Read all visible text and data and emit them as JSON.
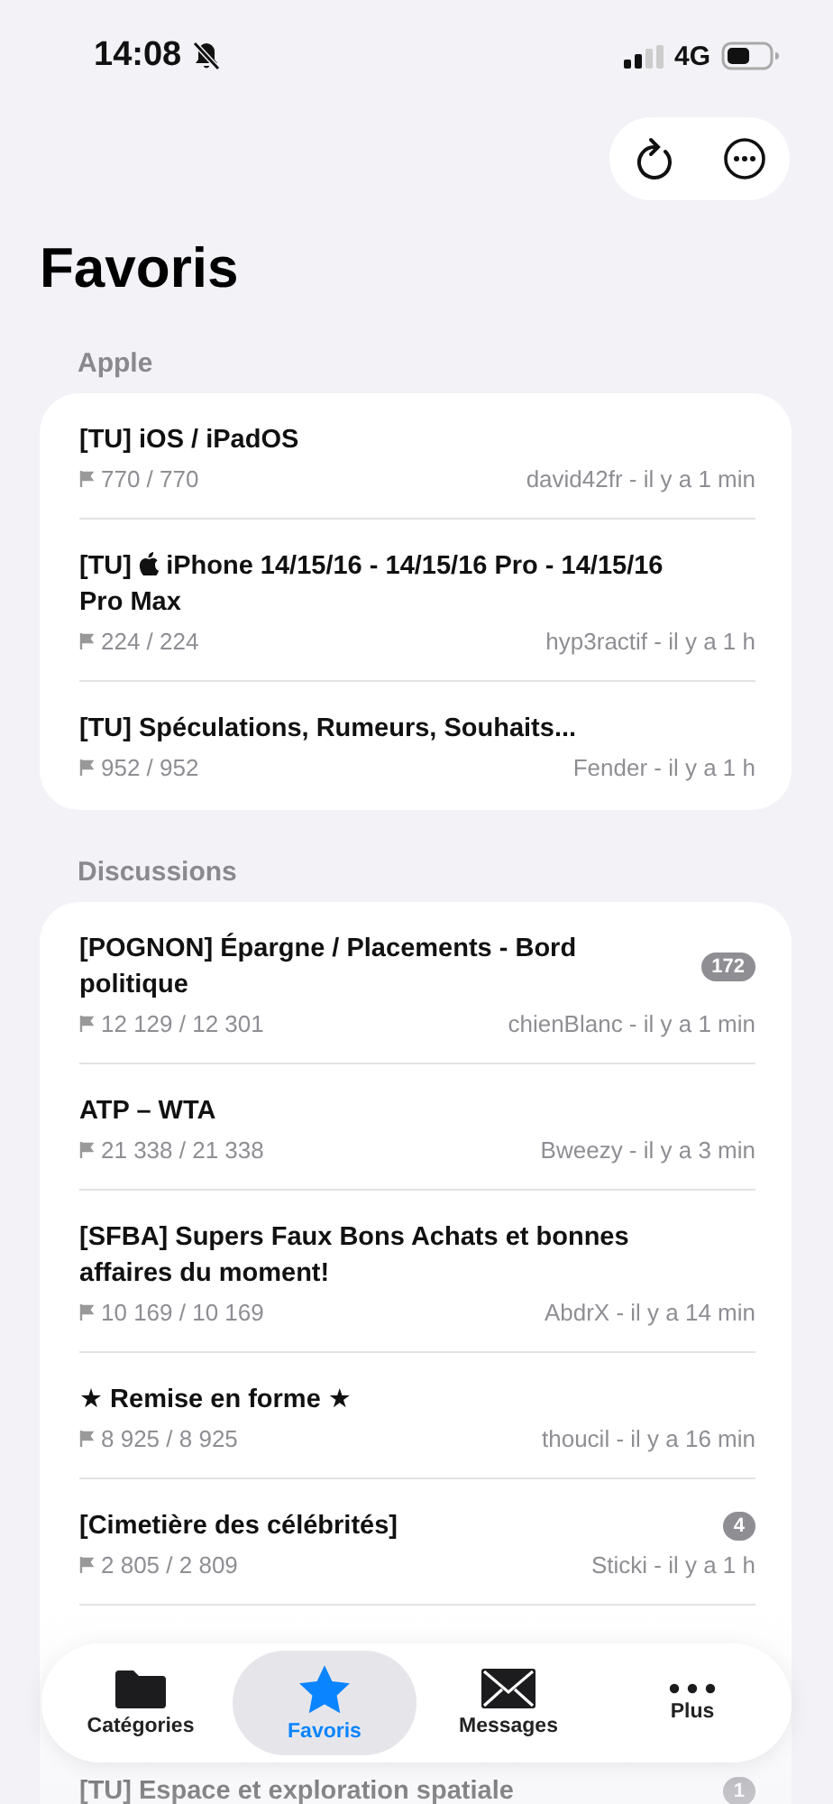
{
  "status_bar": {
    "time": "14:08",
    "network": "4G"
  },
  "title": "Favoris",
  "sections": [
    {
      "label": "Apple",
      "rows": [
        {
          "title": "[TU] iOS / iPadOS",
          "count": "770 / 770",
          "meta": "david42fr - il y a 1 min"
        },
        {
          "prefix": "[TU]",
          "logo": true,
          "title": "iPhone 14/15/16 - 14/15/16 Pro - 14/15/16 Pro Max",
          "count": "224 / 224",
          "meta": "hyp3ractif - il y a 1 h"
        },
        {
          "title": "[TU] Spéculations, Rumeurs, Souhaits...",
          "count": "952 / 952",
          "meta": "Fender - il y a 1 h"
        }
      ]
    },
    {
      "label": "Discussions",
      "rows": [
        {
          "title": "[POGNON] Épargne / Placements - Bord politique",
          "count": "12 129 / 12 301",
          "meta": "chienBlanc - il y a 1 min",
          "badge": "172"
        },
        {
          "title": "ATP – WTA",
          "count": "21 338 / 21 338",
          "meta": "Bweezy - il y a 3 min"
        },
        {
          "title": "[SFBA] Supers Faux Bons Achats et bonnes affaires du moment!",
          "count": "10 169 / 10 169",
          "meta": "AbdrX - il y a 14 min"
        },
        {
          "title": "★ Remise en forme ★",
          "count": "8 925 / 8 925",
          "meta": "thoucil - il y a 16 min"
        },
        {
          "title": "[Cimetière des célébrités]",
          "count": "2 805 / 2 809",
          "meta": "Sticki - il y a 1 h",
          "badge": "4"
        },
        {
          "kind": "hidden"
        },
        {
          "title": "[TU] Espace et exploration spatiale",
          "badge": "1"
        }
      ]
    }
  ],
  "tabs": [
    {
      "label": "Catégories",
      "selected": false
    },
    {
      "label": "Favoris",
      "selected": true
    },
    {
      "label": "Messages",
      "selected": false
    },
    {
      "label": "Plus",
      "selected": false
    }
  ]
}
